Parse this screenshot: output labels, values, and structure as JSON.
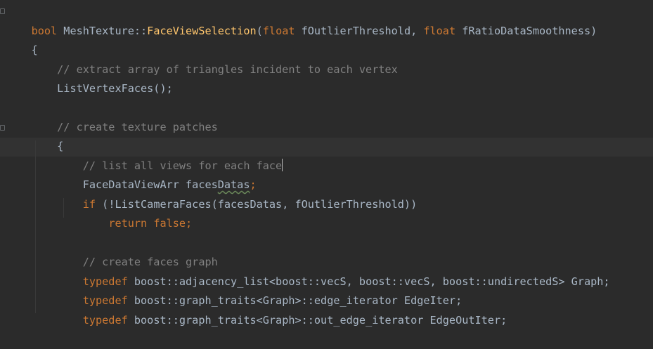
{
  "editor": {
    "theme_colors": {
      "background": "#2b2b2b",
      "keyword": "#cc7832",
      "function": "#ffc66d",
      "comment": "#808080",
      "text": "#a9b7c6"
    },
    "lines": [
      {
        "t1": "bool",
        "t2": " MeshTexture::",
        "t3": "FaceViewSelection",
        "t4": "(",
        "t5": "float",
        "t6": " fOutlierThreshold, ",
        "t7": "float",
        "t8": " fRatioDataSmoothness)"
      },
      {
        "t1": "{"
      },
      {
        "t1": "    // extract array of triangles incident to each vertex"
      },
      {
        "t1": "    ListVertexFaces();"
      },
      {
        "t1": ""
      },
      {
        "t1": "    // create texture patches"
      },
      {
        "t1": "    {"
      },
      {
        "t1": "        // list all views for each face"
      },
      {
        "t1": "        FaceDataViewArr faces",
        "t2": "Datas",
        "t3": ";"
      },
      {
        "t1": "        ",
        "t2": "if",
        "t3": " (!ListCameraFaces(facesDatas, fOutlierThreshold))"
      },
      {
        "t1": "            ",
        "t2": "return false",
        "t3": ";"
      },
      {
        "t1": ""
      },
      {
        "t1": "        // create faces graph"
      },
      {
        "t1": "        ",
        "t2": "typedef",
        "t3": " boost::adjacency_list<boost::vecS, boost::vecS, boost::undirectedS> Graph;"
      },
      {
        "t1": "        ",
        "t2": "typedef",
        "t3": " boost::graph_traits<Graph>::edge_iterator EdgeIter;"
      },
      {
        "t1": "        ",
        "t2": "typedef",
        "t3": " boost::graph_traits<Graph>::out_edge_iterator EdgeOutIter;"
      }
    ]
  }
}
